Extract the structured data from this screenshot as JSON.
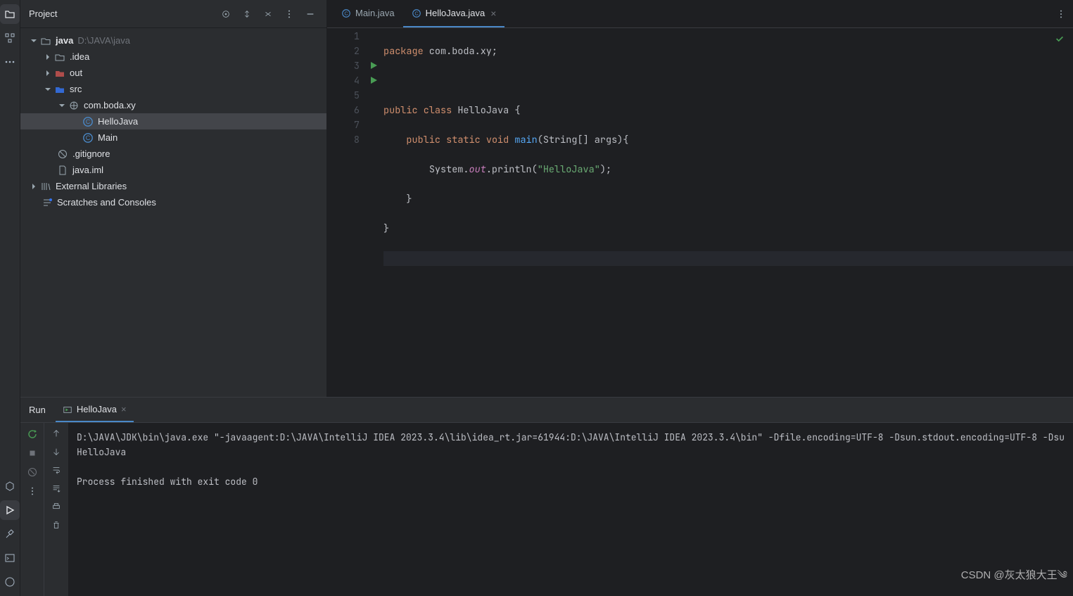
{
  "project_panel": {
    "title": "Project",
    "tree": {
      "root": {
        "label": "java",
        "secondary": "D:\\JAVA\\java"
      },
      "idea": ".idea",
      "out": "out",
      "src": "src",
      "package": "com.boda.xy",
      "hellojava": "HelloJava",
      "main": "Main",
      "gitignore": ".gitignore",
      "iml": "java.iml",
      "external_libs": "External Libraries",
      "scratches": "Scratches and Consoles"
    }
  },
  "editor": {
    "tabs": {
      "main": "Main.java",
      "hellojava": "HelloJava.java"
    },
    "code": {
      "l1_kw": "package",
      "l1_rest": " com.boda.xy;",
      "l3_kw1": "public",
      "l3_kw2": "class",
      "l3_name": "HelloJava",
      "l3_brace": " {",
      "l4_kw1": "public",
      "l4_kw2": "static",
      "l4_kw3": "void",
      "l4_fn": "main",
      "l4_args": "(String[] args){",
      "l5_sys": "System.",
      "l5_out": "out",
      "l5_call": ".println(",
      "l5_str": "\"HelloJava\"",
      "l5_end": ");",
      "l6": "    }",
      "l7": "}"
    },
    "line_numbers": [
      "1",
      "2",
      "3",
      "4",
      "5",
      "6",
      "7",
      "8"
    ]
  },
  "run_panel": {
    "title": "Run",
    "tab": "HelloJava",
    "console": {
      "cmd": "D:\\JAVA\\JDK\\bin\\java.exe \"-javaagent:D:\\JAVA\\IntelliJ IDEA 2023.3.4\\lib\\idea_rt.jar=61944:D:\\JAVA\\IntelliJ IDEA 2023.3.4\\bin\" -Dfile.encoding=UTF-8 -Dsun.stdout.encoding=UTF-8 -Dsu",
      "output": "HelloJava",
      "exit": "Process finished with exit code 0"
    }
  },
  "watermark": "CSDN @灰太狼大王༄"
}
